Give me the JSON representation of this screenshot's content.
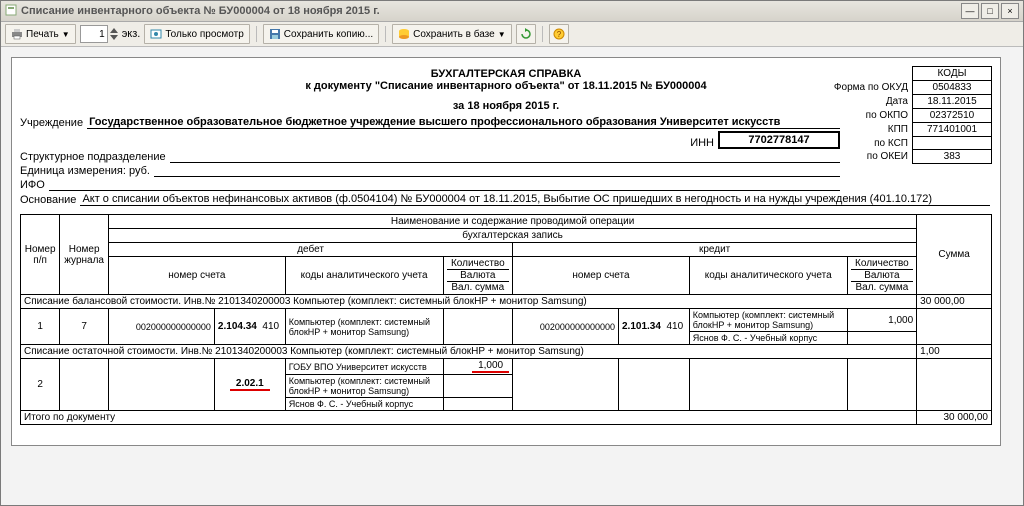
{
  "window": {
    "title": "Списание инвентарного объекта № БУ000004 от 18 ноября 2015 г."
  },
  "toolbar": {
    "print": "Печать",
    "copies": "1",
    "copies_suffix": "экз.",
    "preview": "Только просмотр",
    "save_copy": "Сохранить копию...",
    "save_db": "Сохранить в базе",
    "help": "?"
  },
  "header": {
    "title": "БУХГАЛТЕРСКАЯ СПРАВКА",
    "subtitle": "к документу \"Списание инвентарного объекта\" от 18.11.2015 № БУ000004",
    "date_line": "за 18 ноября 2015 г."
  },
  "codes": {
    "header": "КОДЫ",
    "form_label": "Форма по ОКУД",
    "form": "0504833",
    "date_label": "Дата",
    "date": "18.11.2015",
    "okpo_label": "по ОКПО",
    "okpo": "02372510",
    "kpp_label": "КПП",
    "kpp": "771401001",
    "ksp_label": "по КСП",
    "ksp": "",
    "okei_label": "по ОКЕИ",
    "okei": "383"
  },
  "fields": {
    "org_label": "Учреждение",
    "org": "Государственное образовательное бюджетное учреждение высшего профессионального образования  Университет искусств",
    "inn_label": "ИНН",
    "inn": "7702778147",
    "dept_label": "Структурное подразделение",
    "dept": "",
    "unit_label": "Единица измерения: руб.",
    "ifo_label": "ИФО",
    "ifo": "",
    "basis_label": "Основание",
    "basis": "Акт о списании объектов нефинансовых активов (ф.0504104) № БУ000004 от 18.11.2015, Выбытие ОС пришедших в негодность и на нужды учреждения (401.10.172)"
  },
  "thead": {
    "no": "Номер п/п",
    "jrn": "Номер журнала",
    "op_name": "Наименование и содержание проводимой операции",
    "entry": "бухгалтерская запись",
    "debit": "дебет",
    "credit": "кредит",
    "acct": "номер счета",
    "anal": "коды аналитического учета",
    "qty": "Количество",
    "cur": "Валюта",
    "vsum": "Вал. сумма",
    "sum": "Сумма"
  },
  "section1": {
    "title": "Списание балансовой стоимости. Инв.№ 2101340200003 Компьютер (комплект: системный блокHP + монитор Samsung)",
    "sum": "30 000,00"
  },
  "row1": {
    "no": "1",
    "jrn": "7",
    "d_acct_code": "002000000000000",
    "d_acct": "2.104.34",
    "d_sub": "410",
    "d_anal": "Компьютер (комплект: системный блокHP + монитор Samsung)",
    "c_acct_code": "002000000000000",
    "c_acct": "2.101.34",
    "c_sub": "410",
    "c_anal1": "Компьютер (комплект: системный блокHP + монитор Samsung)",
    "c_qty": "1,000",
    "c_anal2": "Яснов Ф. С. - Учебный корпус"
  },
  "section2": {
    "title": "Списание остаточной стоимости. Инв.№ 2101340200003 Компьютер (комплект: системный блокHP + монитор Samsung)",
    "sum": "1,00"
  },
  "row2": {
    "no": "2",
    "d_acct": "2.02.1",
    "d_anal1": "ГОБУ ВПО Университет искусств",
    "d_qty": "1,000",
    "d_anal2": "Компьютер (комплект: системный блокHP + монитор Samsung)",
    "d_anal3": "Яснов Ф. С. - Учебный корпус"
  },
  "totals": {
    "label": "Итого по документу",
    "sum": "30 000,00"
  }
}
